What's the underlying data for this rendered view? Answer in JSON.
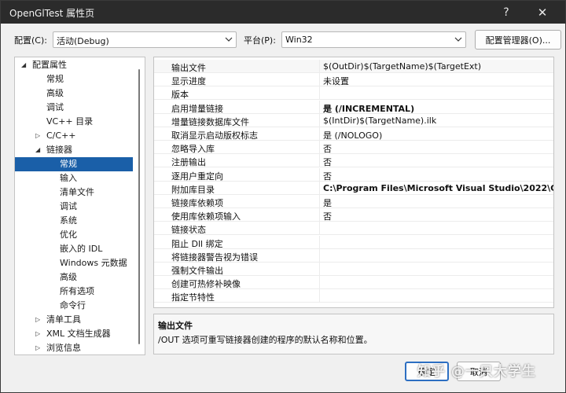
{
  "window": {
    "title": "OpenGlTest 属性页",
    "help_glyph": "?",
    "close_glyph": "✕"
  },
  "config_bar": {
    "config_label": "配置(C):",
    "config_value": "活动(Debug)",
    "platform_label": "平台(P):",
    "platform_value": "Win32",
    "manager_button": "配置管理器(O)..."
  },
  "tree": {
    "items": [
      {
        "label": "配置属性",
        "level": 0,
        "expander": "expanded"
      },
      {
        "label": "常规",
        "level": 1,
        "expander": ""
      },
      {
        "label": "高级",
        "level": 1,
        "expander": ""
      },
      {
        "label": "调试",
        "level": 1,
        "expander": ""
      },
      {
        "label": "VC++ 目录",
        "level": 1,
        "expander": ""
      },
      {
        "label": "C/C++",
        "level": 1,
        "expander": "collapsed"
      },
      {
        "label": "链接器",
        "level": 1,
        "expander": "expanded"
      },
      {
        "label": "常规",
        "level": 2,
        "expander": "",
        "selected": true
      },
      {
        "label": "输入",
        "level": 2,
        "expander": ""
      },
      {
        "label": "清单文件",
        "level": 2,
        "expander": ""
      },
      {
        "label": "调试",
        "level": 2,
        "expander": ""
      },
      {
        "label": "系统",
        "level": 2,
        "expander": ""
      },
      {
        "label": "优化",
        "level": 2,
        "expander": ""
      },
      {
        "label": "嵌入的 IDL",
        "level": 2,
        "expander": ""
      },
      {
        "label": "Windows 元数据",
        "level": 2,
        "expander": ""
      },
      {
        "label": "高级",
        "level": 2,
        "expander": ""
      },
      {
        "label": "所有选项",
        "level": 2,
        "expander": ""
      },
      {
        "label": "命令行",
        "level": 2,
        "expander": ""
      },
      {
        "label": "清单工具",
        "level": 1,
        "expander": "collapsed"
      },
      {
        "label": "XML 文档生成器",
        "level": 1,
        "expander": "collapsed"
      },
      {
        "label": "浏览信息",
        "level": 1,
        "expander": "collapsed"
      }
    ]
  },
  "grid": {
    "rows": [
      {
        "name": "输出文件",
        "value": "$(OutDir)$(TargetName)$(TargetExt)",
        "bold": false,
        "selected": true
      },
      {
        "name": "显示进度",
        "value": "未设置",
        "bold": false
      },
      {
        "name": "版本",
        "value": "",
        "bold": false
      },
      {
        "name": "启用增量链接",
        "value": "是 (/INCREMENTAL)",
        "bold": true
      },
      {
        "name": "增量链接数据库文件",
        "value": "$(IntDir)$(TargetName).ilk",
        "bold": false
      },
      {
        "name": "取消显示启动版权标志",
        "value": "是 (/NOLOGO)",
        "bold": false
      },
      {
        "name": "忽略导入库",
        "value": "否",
        "bold": false
      },
      {
        "name": "注册输出",
        "value": "否",
        "bold": false
      },
      {
        "name": "逐用户重定向",
        "value": "否",
        "bold": false
      },
      {
        "name": "附加库目录",
        "value": "C:\\Program Files\\Microsoft Visual Studio\\2022\\Comr",
        "bold": true
      },
      {
        "name": "链接库依赖项",
        "value": "是",
        "bold": false
      },
      {
        "name": "使用库依赖项输入",
        "value": "否",
        "bold": false
      },
      {
        "name": "链接状态",
        "value": "",
        "bold": false
      },
      {
        "name": "阻止 Dll 绑定",
        "value": "",
        "bold": false
      },
      {
        "name": "将链接器警告视为错误",
        "value": "",
        "bold": false
      },
      {
        "name": "强制文件输出",
        "value": "",
        "bold": false
      },
      {
        "name": "创建可热修补映像",
        "value": "",
        "bold": false
      },
      {
        "name": "指定节特性",
        "value": "",
        "bold": false
      }
    ]
  },
  "description": {
    "title": "输出文件",
    "text": "/OUT 选项可重写链接器创建的程序的默认名称和位置。"
  },
  "buttons": {
    "ok": "确定",
    "cancel": "取消"
  },
  "watermark": "知乎 @一只大学生",
  "colors": {
    "selection": "#1a5fa8",
    "titlebar": "#2b2b2b",
    "ok_border": "#2d6fc2"
  }
}
